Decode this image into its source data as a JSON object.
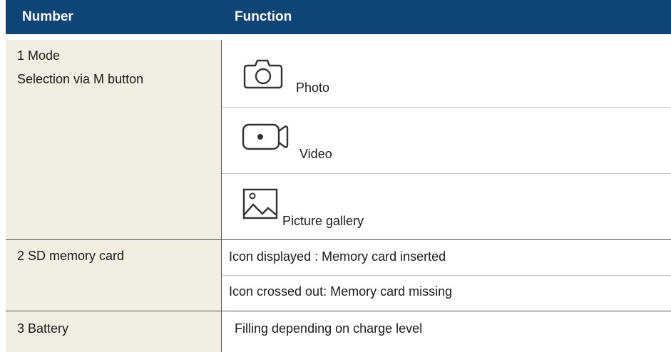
{
  "header": {
    "col1": "Number",
    "col2": "Function"
  },
  "rows": {
    "mode": {
      "title": "1 Mode",
      "subtitle": "Selection via M button",
      "options": [
        {
          "icon": "camera-icon",
          "label": "Photo"
        },
        {
          "icon": "video-camera-icon",
          "label": "Video"
        },
        {
          "icon": "picture-gallery-icon",
          "label": "Picture gallery"
        }
      ]
    },
    "sd": {
      "title": "2 SD memory card",
      "lines": [
        "Icon displayed : Memory card inserted",
        "Icon crossed out: Memory card missing"
      ]
    },
    "battery": {
      "title": "3 Battery",
      "line": "Filling depending on charge level"
    }
  },
  "colors": {
    "header_bg": "#0e4478",
    "left_bg": "#f3eee4"
  }
}
